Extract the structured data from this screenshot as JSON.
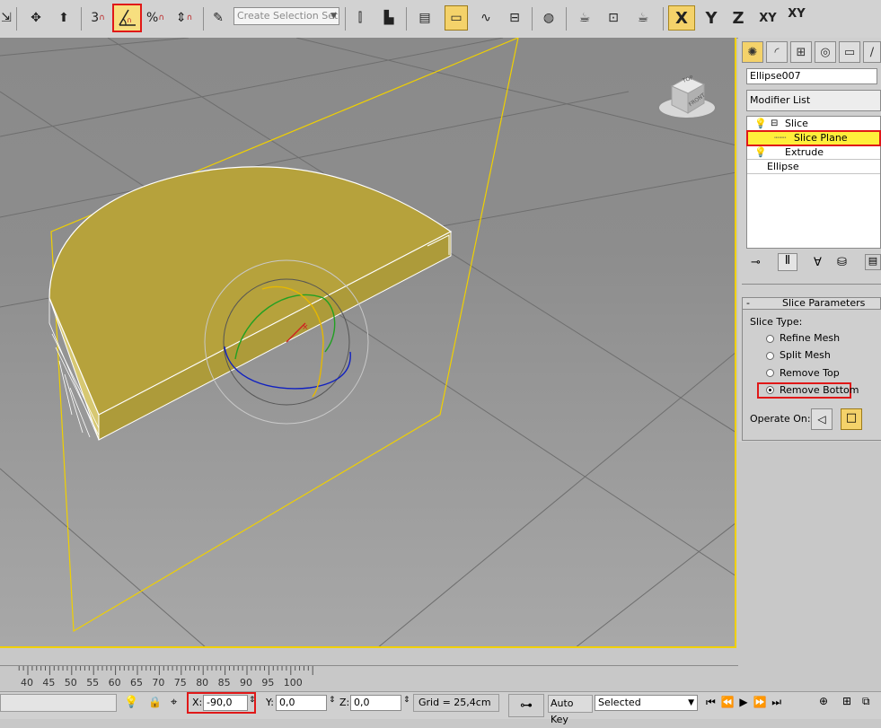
{
  "toolbar": {
    "snap_counter": "3",
    "percent_snap": "%",
    "selection_set_placeholder": "Create Selection Set",
    "axis_x": "X",
    "axis_y": "Y",
    "axis_z": "Z",
    "axis_xy": "XY",
    "axis_xy2": "XY"
  },
  "viewcube": {
    "top_label": "TOP",
    "front_label": "FRONT"
  },
  "panel": {
    "object_name": "Ellipse007",
    "modifier_list": "Modifier List",
    "stack": [
      {
        "label": "Slice"
      },
      {
        "label": "Slice Plane"
      },
      {
        "label": "Extrude"
      },
      {
        "label": "Ellipse"
      }
    ],
    "rollout_toggle": "-",
    "rollout_title": "Slice Parameters",
    "slice_type_label": "Slice Type:",
    "slice_types": [
      {
        "label": "Refine Mesh",
        "selected": false
      },
      {
        "label": "Split Mesh",
        "selected": false
      },
      {
        "label": "Remove Top",
        "selected": false
      },
      {
        "label": "Remove Bottom",
        "selected": true
      }
    ],
    "operate_on_label": "Operate On:"
  },
  "timeline": {
    "ticks": [
      "40",
      "45",
      "50",
      "55",
      "60",
      "65",
      "70",
      "75",
      "80",
      "85",
      "90",
      "95",
      "100"
    ]
  },
  "status": {
    "x_label": "X:",
    "x_value": "-90,0",
    "y_label": "Y:",
    "y_value": "0,0",
    "z_label": "Z:",
    "z_value": "0,0",
    "grid": "Grid = 25,4cm",
    "auto_key": "Auto Key",
    "key_filter": "Selected"
  },
  "colors": {
    "accent_yellow": "#f0d000",
    "object_fill": "#b6a23c",
    "highlight_red": "#e01818"
  }
}
